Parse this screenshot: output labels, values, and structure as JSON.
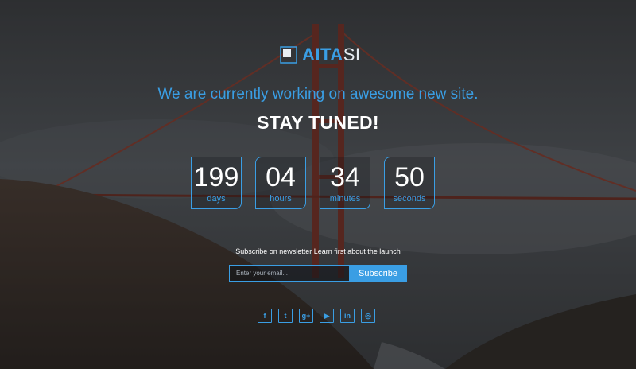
{
  "brand": {
    "bold": "AITA",
    "light": "SI"
  },
  "tagline": "We are currently working on awesome new site.",
  "headline": "STAY TUNED!",
  "countdown": [
    {
      "value": "199",
      "label": "days"
    },
    {
      "value": "04",
      "label": "hours"
    },
    {
      "value": "34",
      "label": "minutes"
    },
    {
      "value": "50",
      "label": "seconds"
    }
  ],
  "subscribe": {
    "text": "Subscribe on newsletter Learn first about the launch",
    "placeholder": "Enter your email...",
    "button": "Subscribe"
  },
  "social": [
    {
      "icon": "facebook-icon",
      "glyph": "f"
    },
    {
      "icon": "twitter-icon",
      "glyph": "t"
    },
    {
      "icon": "google-plus-icon",
      "glyph": "g+"
    },
    {
      "icon": "youtube-icon",
      "glyph": "▶"
    },
    {
      "icon": "linkedin-icon",
      "glyph": "in"
    },
    {
      "icon": "instagram-icon",
      "glyph": "◎"
    }
  ],
  "colors": {
    "accent": "#3a9ee4",
    "text": "#ffffff",
    "background": "#2c2d2e"
  }
}
